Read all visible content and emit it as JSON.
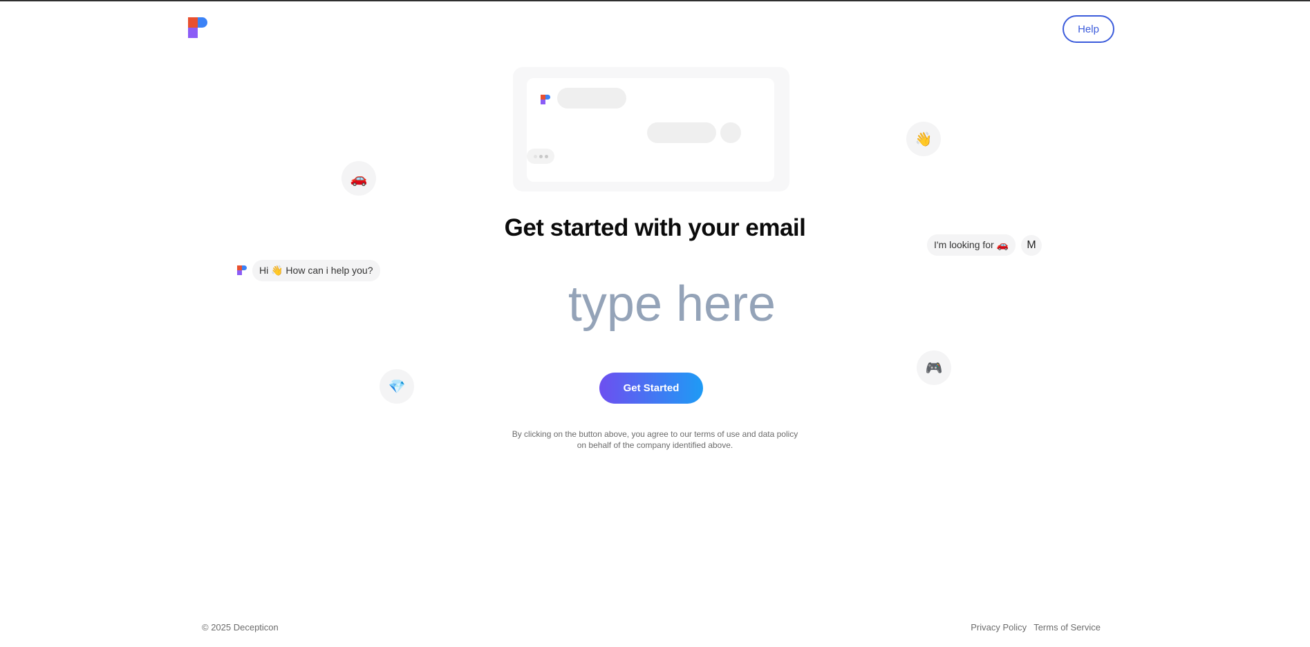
{
  "header": {
    "logo_name": "brand-logo",
    "help_label": "Help"
  },
  "hero": {
    "title": "Get started with your email",
    "email_placeholder": "type here",
    "cta_label": "Get Started",
    "disclaimer_line1": "By clicking on the button above, you agree to our terms of use and data policy",
    "disclaimer_line2": "on behalf of the company identified above."
  },
  "decor": {
    "chat_left": "Hi 👋 How can i help you?",
    "chat_right": "I'm looking for 🚗",
    "avatar_initial": "M",
    "emoji_car": "🚗",
    "emoji_wave": "👋",
    "emoji_gem": "💎",
    "emoji_gamepad": "🎮"
  },
  "footer": {
    "copyright": "© 2025 Decepticon",
    "privacy": "Privacy Policy",
    "terms": "Terms of Service"
  },
  "colors": {
    "accent": "#3b5bdb",
    "gradient_start": "#6d4ff0",
    "gradient_end": "#1e9bf5",
    "placeholder": "#94a3b8"
  }
}
